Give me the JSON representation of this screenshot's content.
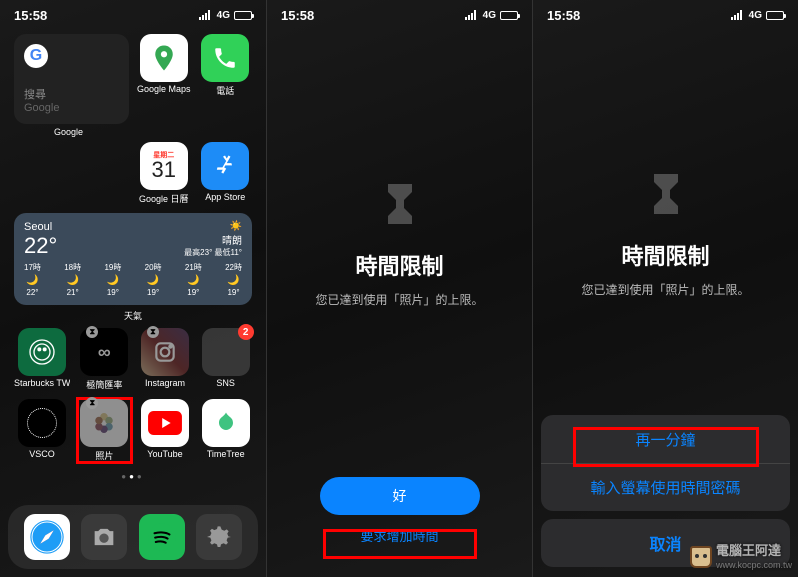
{
  "status": {
    "time": "15:58",
    "network": "4G"
  },
  "s1": {
    "google_widget": {
      "search_label": "搜尋",
      "brand": "Google",
      "name": "Google"
    },
    "apps_r1": [
      {
        "label": "Google Maps",
        "name": "google-maps"
      },
      {
        "label": "電話",
        "name": "phone"
      }
    ],
    "apps_r2": [
      {
        "label": "Google 日曆",
        "name": "google-calendar",
        "dow": "星期二",
        "day": "31"
      },
      {
        "label": "App Store",
        "name": "app-store"
      }
    ],
    "weather": {
      "name": "天氣",
      "city": "Seoul",
      "temp": "22°",
      "cond": "晴朗",
      "hi_lo": "最高23° 最低11°",
      "hours": [
        {
          "t": "17時",
          "temp": "22°"
        },
        {
          "t": "18時",
          "temp": "21°"
        },
        {
          "t": "19時",
          "temp": "19°"
        },
        {
          "t": "20時",
          "temp": "19°"
        },
        {
          "t": "21時",
          "temp": "19°"
        },
        {
          "t": "22時",
          "temp": "19°"
        }
      ]
    },
    "apps_r3": [
      {
        "label": "Starbucks TW",
        "name": "starbucks"
      },
      {
        "label": "極簡匯率",
        "name": "rate",
        "dimmed": true,
        "hg": true
      },
      {
        "label": "Instagram",
        "name": "instagram",
        "dimmed": true,
        "hg": true
      },
      {
        "label": "SNS",
        "name": "sns-folder",
        "badge": "2"
      }
    ],
    "apps_r4": [
      {
        "label": "VSCO",
        "name": "vsco"
      },
      {
        "label": "照片",
        "name": "photos",
        "dimmed": true,
        "hg": true,
        "red": true
      },
      {
        "label": "YouTube",
        "name": "youtube"
      },
      {
        "label": "TimeTree",
        "name": "timetree"
      }
    ],
    "dock": [
      {
        "name": "safari"
      },
      {
        "name": "camera"
      },
      {
        "name": "spotify"
      },
      {
        "name": "settings"
      }
    ]
  },
  "s2": {
    "title": "時間限制",
    "subtitle": "您已達到使用「照片」的上限。",
    "ok": "好",
    "request": "要求增加時間"
  },
  "s3": {
    "title": "時間限制",
    "subtitle": "您已達到使用「照片」的上限。",
    "one_more": "再一分鐘",
    "passcode": "輸入螢幕使用時間密碼",
    "cancel": "取消"
  },
  "watermark": {
    "brand": "電腦王阿達",
    "url": "www.kocpc.com.tw"
  }
}
